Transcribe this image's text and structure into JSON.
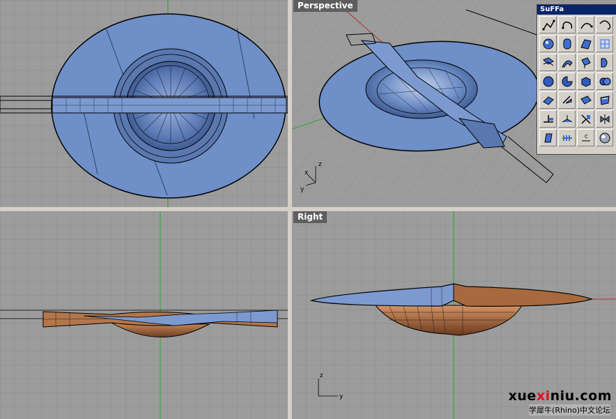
{
  "viewports": {
    "top": {
      "label": ""
    },
    "perspective": {
      "label": "Perspective"
    },
    "front": {
      "label": ""
    },
    "right": {
      "label": "Right"
    }
  },
  "axes": {
    "x": "x",
    "y": "y",
    "z": "z"
  },
  "toolbar": {
    "title": "SuFFa",
    "buttons": [
      "curve-polyline-icon",
      "curve-closed-icon",
      "curve-arc-icon",
      "curve-spiral-icon",
      "sphere-icon",
      "cylinder-icon",
      "surface-patch-icon",
      "surface-mesh-icon",
      "loft-icon",
      "sweep-icon",
      "extrude-icon",
      "revolve-icon",
      "solid-sphere-icon",
      "solid-wedge-icon",
      "solid-box-icon",
      "solid-union-icon",
      "plane-icon",
      "project-icon",
      "offset-surface-icon",
      "edit-surface-icon",
      "fillet-icon",
      "blend-icon",
      "trim-icon",
      "mirror-icon",
      "bend-icon",
      "unroll-icon",
      "analyze-icon",
      "render-sphere-icon"
    ]
  },
  "watermark": {
    "site_pre": "xue",
    "site_x": "xi",
    "site_post": "niu.com",
    "forum": "学犀牛(Rhino)中文论坛"
  },
  "colors": {
    "viewport_bg": "#9c9c9c",
    "grid_line": "#8a8a8a",
    "surface_blue": "#6f8fc7",
    "surface_copper": "#b3764b",
    "axis_red": "#b0302a",
    "axis_green": "#2aa62a",
    "label_bg": "#5e5e5e"
  }
}
